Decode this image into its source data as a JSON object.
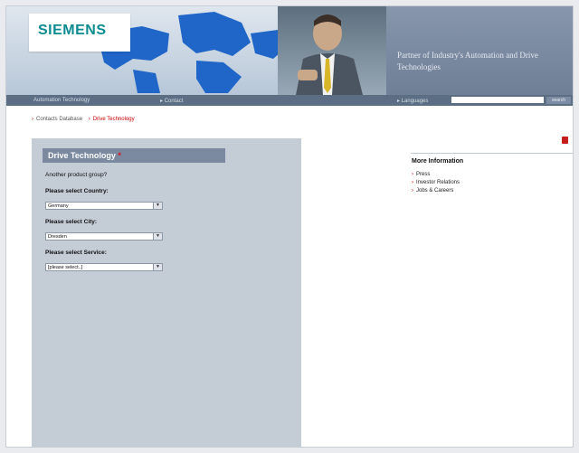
{
  "header": {
    "logo": "SIEMENS",
    "tagline": "Partner of Industry's Automation and Drive Technologies",
    "search_button": "search"
  },
  "nav": {
    "items": [
      "Automation Technology",
      "Contact",
      "Languages"
    ]
  },
  "breadcrumb": {
    "items": [
      "Contacts Database",
      "Drive Technology"
    ]
  },
  "panel": {
    "title": "Drive Technology",
    "title_marker": "*",
    "another_group": "Another product group?",
    "country_label": "Please select Country:",
    "country_value": "Germany",
    "city_label": "Please select City:",
    "city_value": "Dresden",
    "service_label": "Please select Service:",
    "service_value": "[please select..]"
  },
  "more_info": {
    "title": "More Information",
    "items": [
      "Press",
      "Investor Relations",
      "Jobs & Careers"
    ]
  },
  "icons": {
    "breadcrumb_arrow": "arrow-right-icon",
    "dropdown": "chevron-down-icon",
    "print": "pdf-icon"
  },
  "colors": {
    "brand": "#0a8b91",
    "accent": "#cc0000",
    "nav_bg": "#5b6e84",
    "panel_bg": "#c4ccd6"
  }
}
